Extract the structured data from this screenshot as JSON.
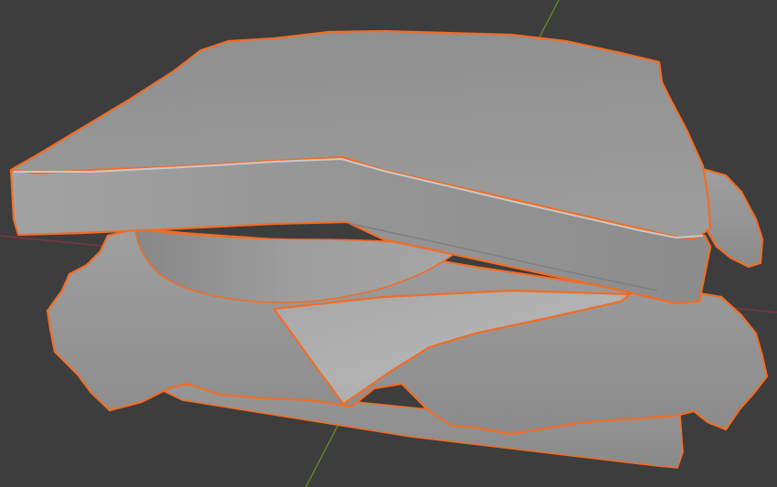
{
  "viewport": {
    "background": "#3d3d3d",
    "axis_colors": {
      "x_axis": "#8a3444",
      "y_axis": "#6b8f23"
    },
    "selection_color": "#f06d27",
    "object_color": "#9c9c9c"
  },
  "scene_objects": [
    {
      "name": "bread-top",
      "selected": true
    },
    {
      "name": "lettuce-top-right",
      "selected": true
    },
    {
      "name": "cheese-slice",
      "selected": true
    },
    {
      "name": "meat-patty",
      "selected": true
    },
    {
      "name": "lettuce-bottom",
      "selected": true
    },
    {
      "name": "bread-bottom",
      "selected": true
    }
  ]
}
